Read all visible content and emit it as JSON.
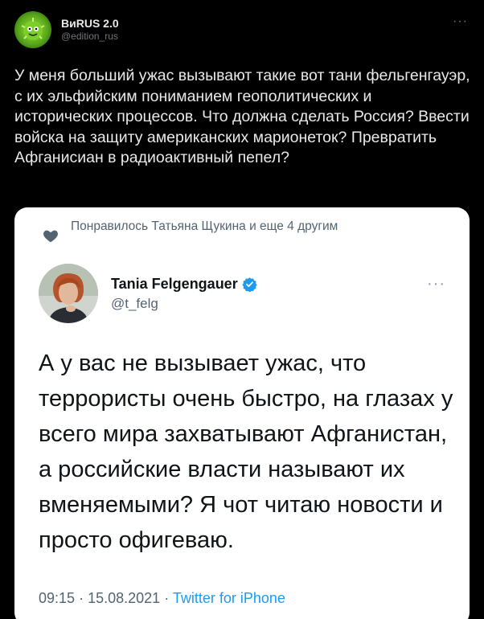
{
  "tweet": {
    "display_name": "ВиRUS 2.0",
    "handle": "@edition_rus",
    "more": "···",
    "text": "У меня больший ужас вызывают такие вот тани фельгенгауэр, с их эльфийским пониманием геополитических и исторических процессов. Что должна сделать Россия? Ввести войска на защиту американских марионеток? Превратить Афганисиан в радиоактивный пепел?"
  },
  "embedded": {
    "liked_by": "Понравилось Татьяна Щукина и еще 4 другим",
    "display_name": "Tania Felgengauer",
    "handle": "@t_felg",
    "more": "···",
    "text": "А у вас не вызывает ужас, что террористы очень быстро, на глазах у всего мира захватывают Афганистан, а российские власти называют их вменяемыми? Я чот читаю новости и просто офигеваю.",
    "time": "09:15",
    "date": "15.08.2021",
    "separator": "·",
    "source": "Twitter for iPhone"
  },
  "colors": {
    "background": "#000000",
    "text_primary": "#e7e9ea",
    "text_secondary": "#71767b",
    "card_background": "#ffffff",
    "link_blue": "#1d9bf0",
    "verified_blue": "#1d9bf0"
  },
  "icons": [
    "virus-avatar",
    "heart-icon",
    "verified-badge-icon",
    "more-icon"
  ]
}
